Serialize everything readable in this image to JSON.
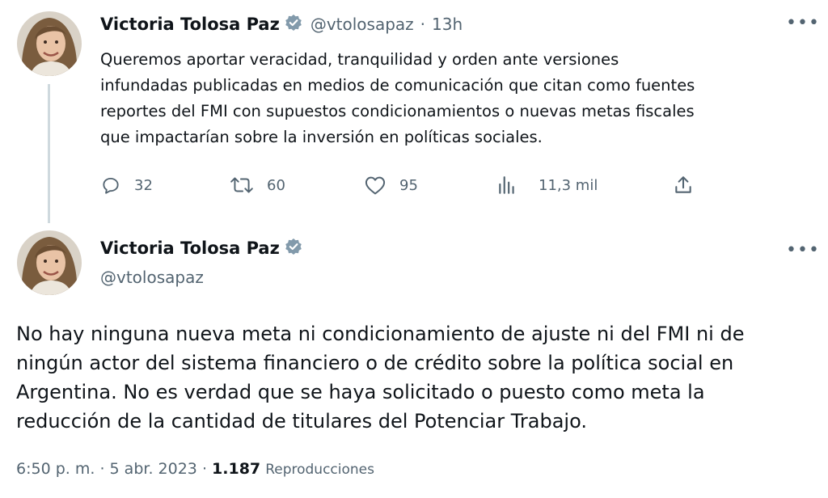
{
  "tweet1": {
    "author_name": "Victoria Tolosa Paz",
    "handle": "@vtolosapaz",
    "separator": "·",
    "time": "13h",
    "text": "Queremos aportar veracidad, tranquilidad y orden ante versiones\ninfundadas publicadas en medios de comunicación que citan como fuentes\nreportes del FMI con supuestos condicionamientos o nuevas metas fiscales\nque impactarían sobre la inversión en políticas sociales.",
    "replies": "32",
    "retweets": "60",
    "likes": "95",
    "views": "11,3 mil"
  },
  "tweet2": {
    "author_name": "Victoria Tolosa Paz",
    "handle": "@vtolosapaz",
    "text": "No hay ninguna nueva meta ni condicionamiento de ajuste ni del FMI ni de\nningún actor del sistema financiero o de crédito sobre la política social en\nArgentina. No es verdad que se haya solicitado o puesto como meta la\nreducción de la cantidad de titulares del Potenciar Trabajo.",
    "time": "6:50 p. m.",
    "date": "5 abr. 2023",
    "separator": "·",
    "views_count": "1.187",
    "views_label": "Reproducciones"
  },
  "icons": {
    "more": "more-icon",
    "reply": "reply-icon",
    "retweet": "retweet-icon",
    "like": "heart-icon",
    "views": "analytics-icon",
    "share": "share-icon",
    "verified": "verified-badge-icon"
  },
  "colors": {
    "text": "#0f1419",
    "secondary": "#536471",
    "thread_line": "#cfd9de",
    "verified_badge": "#829aab"
  }
}
